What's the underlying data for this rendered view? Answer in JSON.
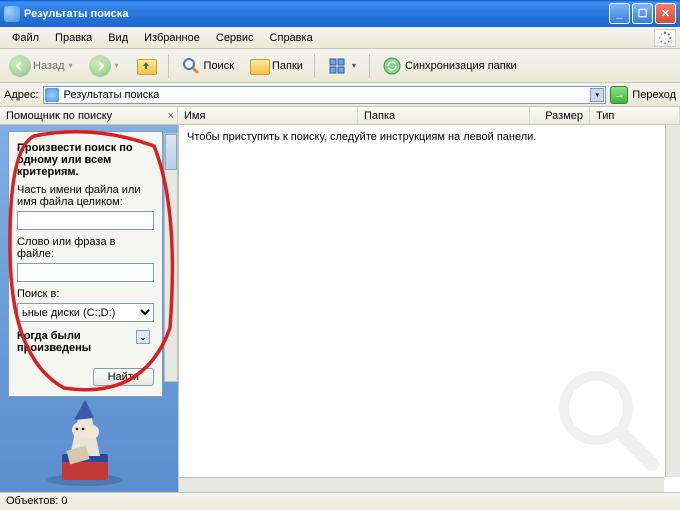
{
  "title": "Результаты поиска",
  "menu": [
    "Файл",
    "Правка",
    "Вид",
    "Избранное",
    "Сервис",
    "Справка"
  ],
  "toolbar": {
    "back": "Назад",
    "search": "Поиск",
    "folders": "Папки",
    "sync": "Синхронизация папки"
  },
  "address": {
    "label": "Адрес:",
    "value": "Результаты поиска",
    "go": "Переход"
  },
  "columns": {
    "helper": "Помощник по поиску",
    "name": "Имя",
    "folder": "Папка",
    "size": "Размер",
    "type": "Тип"
  },
  "panel": {
    "heading": "Произвести поиск по одному или всем критериям.",
    "filename_label": "Часть имени файла или имя файла целиком:",
    "filename_value": "",
    "phrase_label": "Слово или фраза в файле:",
    "phrase_value": "",
    "lookin_label": "Поиск в:",
    "lookin_value": "ьные диски (C:;D:)",
    "when_label": "Когда были произведены",
    "find_btn": "Найти"
  },
  "content_msg": "Чтобы приступить к поиску, следуйте инструкциям на левой панели.",
  "status": "Объектов: 0"
}
